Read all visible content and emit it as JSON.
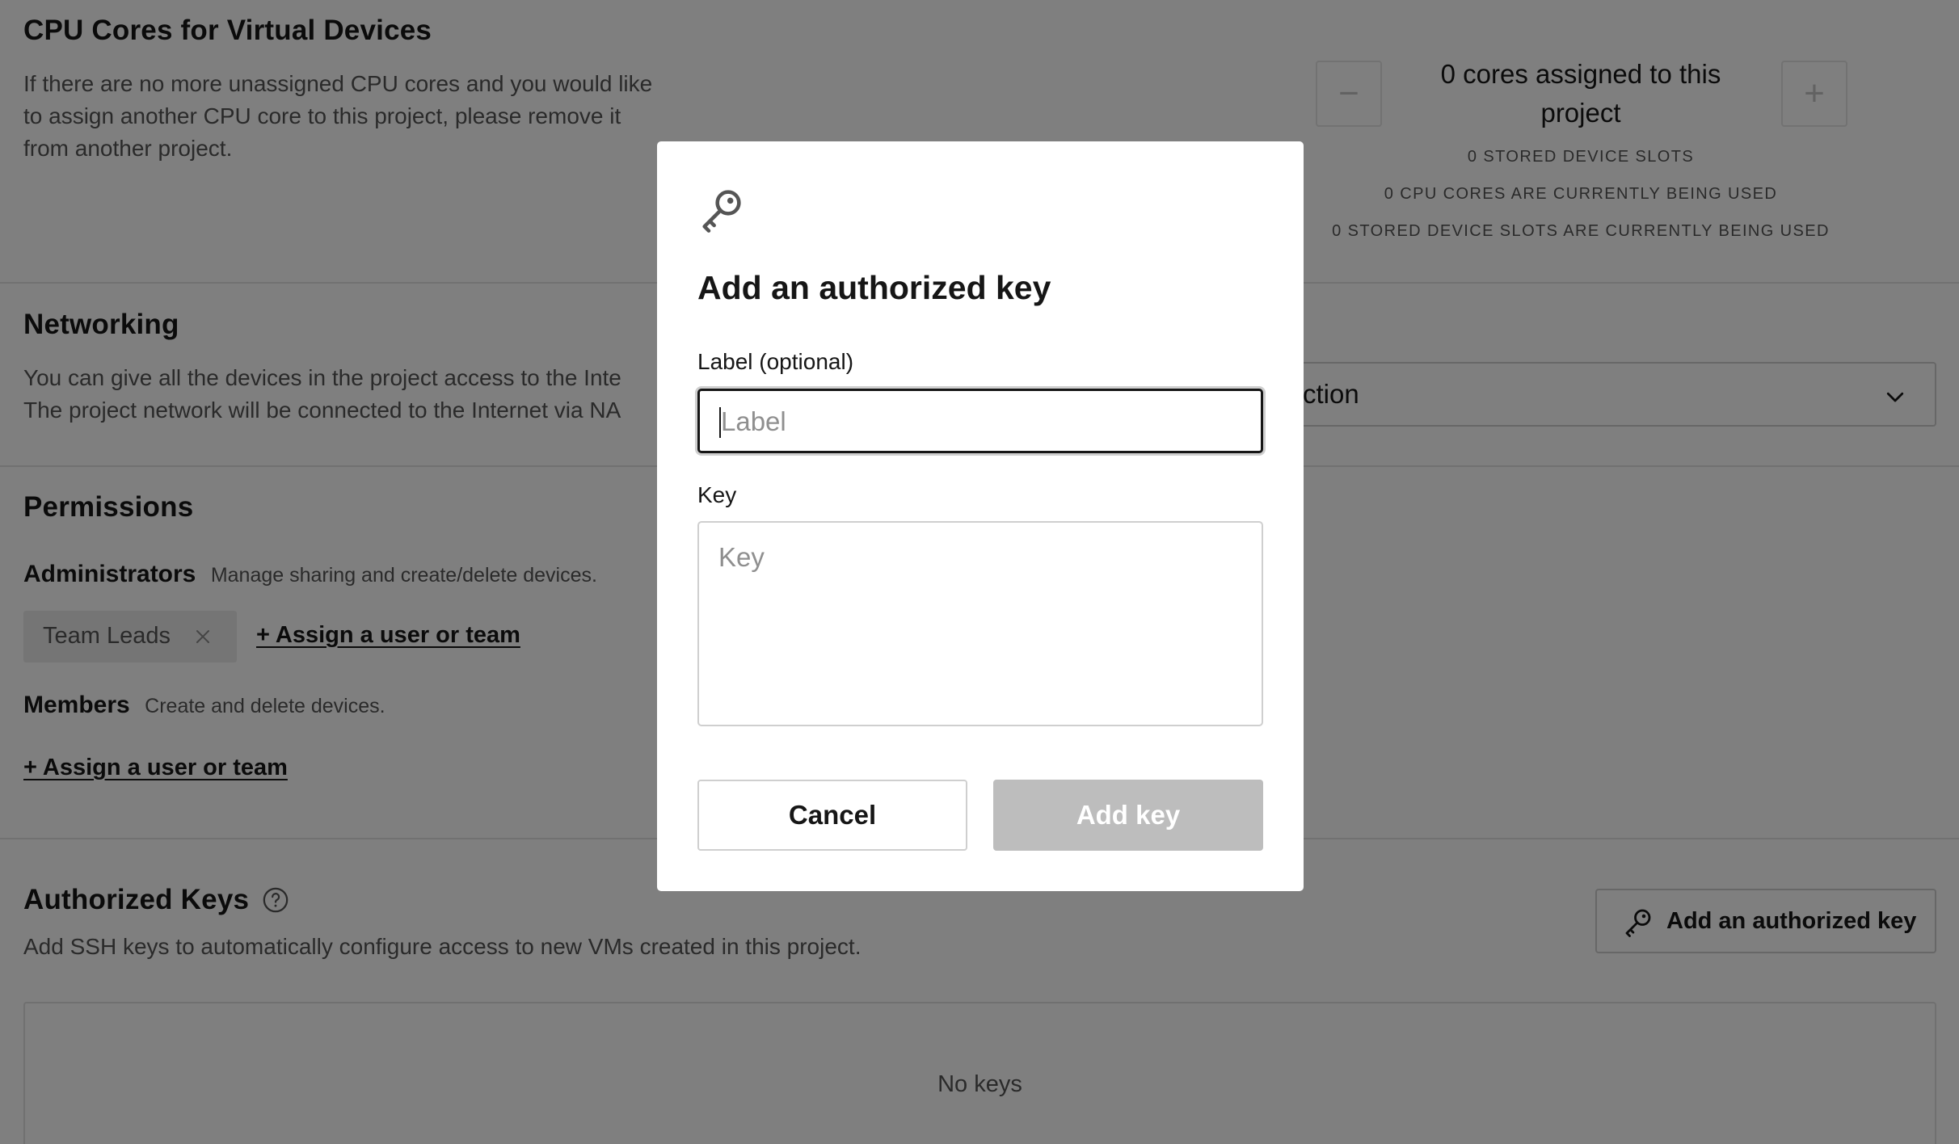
{
  "cpu": {
    "title": "CPU Cores for Virtual Devices",
    "description_lines": [
      "If there are no more unassigned CPU cores and you would like",
      "to assign another CPU core to this project, please remove it",
      "from another project."
    ],
    "assigned_line1": "0 cores assigned to this",
    "assigned_line2": "project",
    "stats": [
      "0 STORED DEVICE SLOTS",
      "0 CPU CORES ARE CURRENTLY BEING USED",
      "0 STORED DEVICE SLOTS ARE CURRENTLY BEING USED"
    ],
    "decrement_symbol": "−",
    "increment_symbol": "+"
  },
  "networking": {
    "title": "Networking",
    "description_lines": [
      "You can give all the devices in the project access to the Inte",
      "The project network will be connected to the Internet via NA"
    ],
    "select_value": "ction"
  },
  "permissions": {
    "title": "Permissions",
    "administrators": {
      "label": "Administrators",
      "description": "Manage sharing and create/delete devices.",
      "chip": "Team Leads",
      "assign_link": "+ Assign a user or team"
    },
    "members": {
      "label": "Members",
      "description": "Create and delete devices.",
      "assign_link": "+ Assign a user or team"
    }
  },
  "authorized_keys": {
    "title": "Authorized Keys",
    "description": "Add SSH keys to automatically configure access to new VMs created in this project.",
    "add_button": "Add an authorized key",
    "empty_text": "No keys"
  },
  "modal": {
    "icon": "key-icon",
    "title": "Add an authorized key",
    "label_field": {
      "label": "Label (optional)",
      "placeholder": "Label",
      "value": ""
    },
    "key_field": {
      "label": "Key",
      "placeholder": "Key",
      "value": ""
    },
    "cancel_label": "Cancel",
    "submit_label": "Add key"
  },
  "colors": {
    "overlay": "#00000080",
    "submit_disabled": "#bdbdbd",
    "text_primary": "#161616",
    "text_secondary": "#555555"
  }
}
